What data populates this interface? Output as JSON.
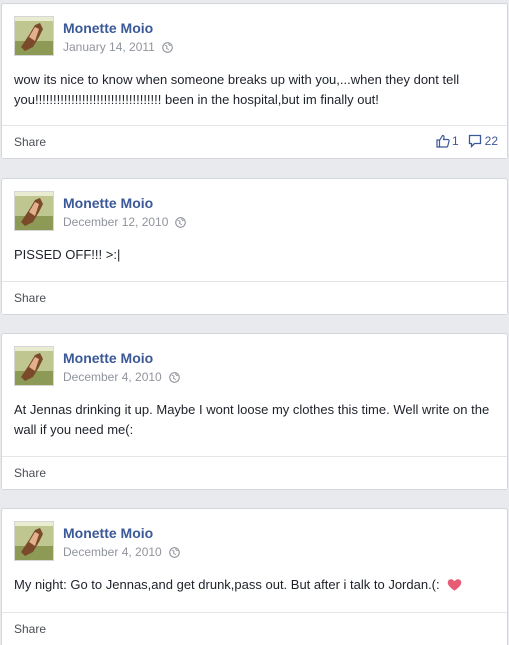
{
  "posts": [
    {
      "author": "Monette Moio",
      "date": "January 14, 2011",
      "text": "wow its nice to know when someone breaks up with you,...when they dont tell you!!!!!!!!!!!!!!!!!!!!!!!!!!!!!!!!!!! been in the hospital,but im finally out!",
      "share_label": "Share",
      "likes": "1",
      "comments": "22"
    },
    {
      "author": "Monette Moio",
      "date": "December 12, 2010",
      "text": "PISSED OFF!!! >:|",
      "share_label": "Share"
    },
    {
      "author": "Monette Moio",
      "date": "December 4, 2010",
      "text": "At Jennas drinking it up. Maybe I wont loose my clothes this time. Well write on the wall if you need me(:",
      "share_label": "Share"
    },
    {
      "author": "Monette Moio",
      "date": "December 4, 2010",
      "text": "My night: Go to Jennas,and get drunk,pass out. But after i talk to Jordan.(:",
      "share_label": "Share",
      "emoji": "heart-emoji"
    }
  ],
  "icons": {
    "globe": "globe-icon",
    "like": "thumbs-up-icon",
    "comment": "comment-icon"
  },
  "colors": {
    "author": "#3b5998",
    "meta": "#90949c",
    "text": "#1d2129",
    "background": "#e9eaed",
    "heart": "#e75b74"
  }
}
